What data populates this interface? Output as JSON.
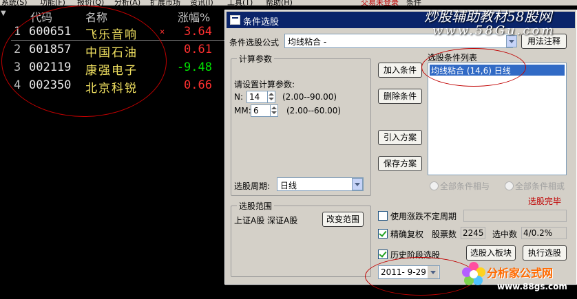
{
  "menubar": {
    "items": [
      "系统(S)",
      "功能(F)",
      "报价(Q)",
      "分析(A)",
      "扩展市场",
      "资讯(I)",
      "工具(T)",
      "帮助(H)"
    ],
    "status": "交易未登录",
    "cut_text": "条件"
  },
  "quote_table": {
    "headers": {
      "code": "代码",
      "name": "名称",
      "change": "涨幅%"
    },
    "rows": [
      {
        "index": "1",
        "code": "600651",
        "name": "飞乐音响",
        "change": "3.64",
        "direction": "up"
      },
      {
        "index": "2",
        "code": "601857",
        "name": "中国石油",
        "change": "0.61",
        "direction": "up"
      },
      {
        "index": "3",
        "code": "002119",
        "name": "康强电子",
        "change": "-9.48",
        "direction": "down"
      },
      {
        "index": "4",
        "code": "002350",
        "name": "北京科锐",
        "change": "0.66",
        "direction": "up"
      }
    ],
    "up_color": "#ff3030",
    "down_color": "#00e000"
  },
  "dialog": {
    "title": "条件选股",
    "formula_label": "条件选股公式",
    "formula_value": "均线粘合 -",
    "usage_button": "用法注释",
    "calc_group": {
      "title": "计算参数",
      "prompt": "请设置计算参数:",
      "params": [
        {
          "label": "N:",
          "value": "14",
          "range": "(2.00--90.00)"
        },
        {
          "label": "MM:",
          "value": "6",
          "range": "(2.00--60.00)"
        }
      ]
    },
    "period_label": "选股周期:",
    "period_value": "日线",
    "range_group": {
      "title": "选股范围",
      "scope": "上证A股 深证A股",
      "change_button": "改变范围"
    },
    "buttons": {
      "add": "加入条件",
      "delete": "删除条件",
      "import": "引入方案",
      "save": "保存方案",
      "to_block": "选股入板块",
      "execute": "执行选股"
    },
    "list_label": "选股条件列表",
    "list_items": [
      "均线粘合 (14,6) 日线"
    ],
    "radio_all_and": "全部条件相与",
    "radio_all_or": "全部条件相或",
    "status_done": "选股完毕",
    "options": {
      "variable_period": {
        "label": "使用涨跌不定周期",
        "checked": false
      },
      "exact_restore": {
        "label": "精确复权",
        "checked": true
      },
      "history": {
        "label": "历史阶段选股",
        "checked": true
      }
    },
    "stock_count_label": "股票数",
    "stock_count_value": "2245",
    "selected_label": "选中数",
    "selected_value": "4/0.2%",
    "date_value": "2011- 9-29"
  },
  "watermarks": {
    "top_title": "炒股辅助教材58股网",
    "top_url": "www.58Gu.com",
    "bottom_title": "分析家公式网",
    "bottom_url": "www.88gs.com"
  },
  "colors": {
    "annotation_red": "#c00000",
    "dialog_title_bg": "#0a246a",
    "selection_bg": "#316ac5"
  }
}
